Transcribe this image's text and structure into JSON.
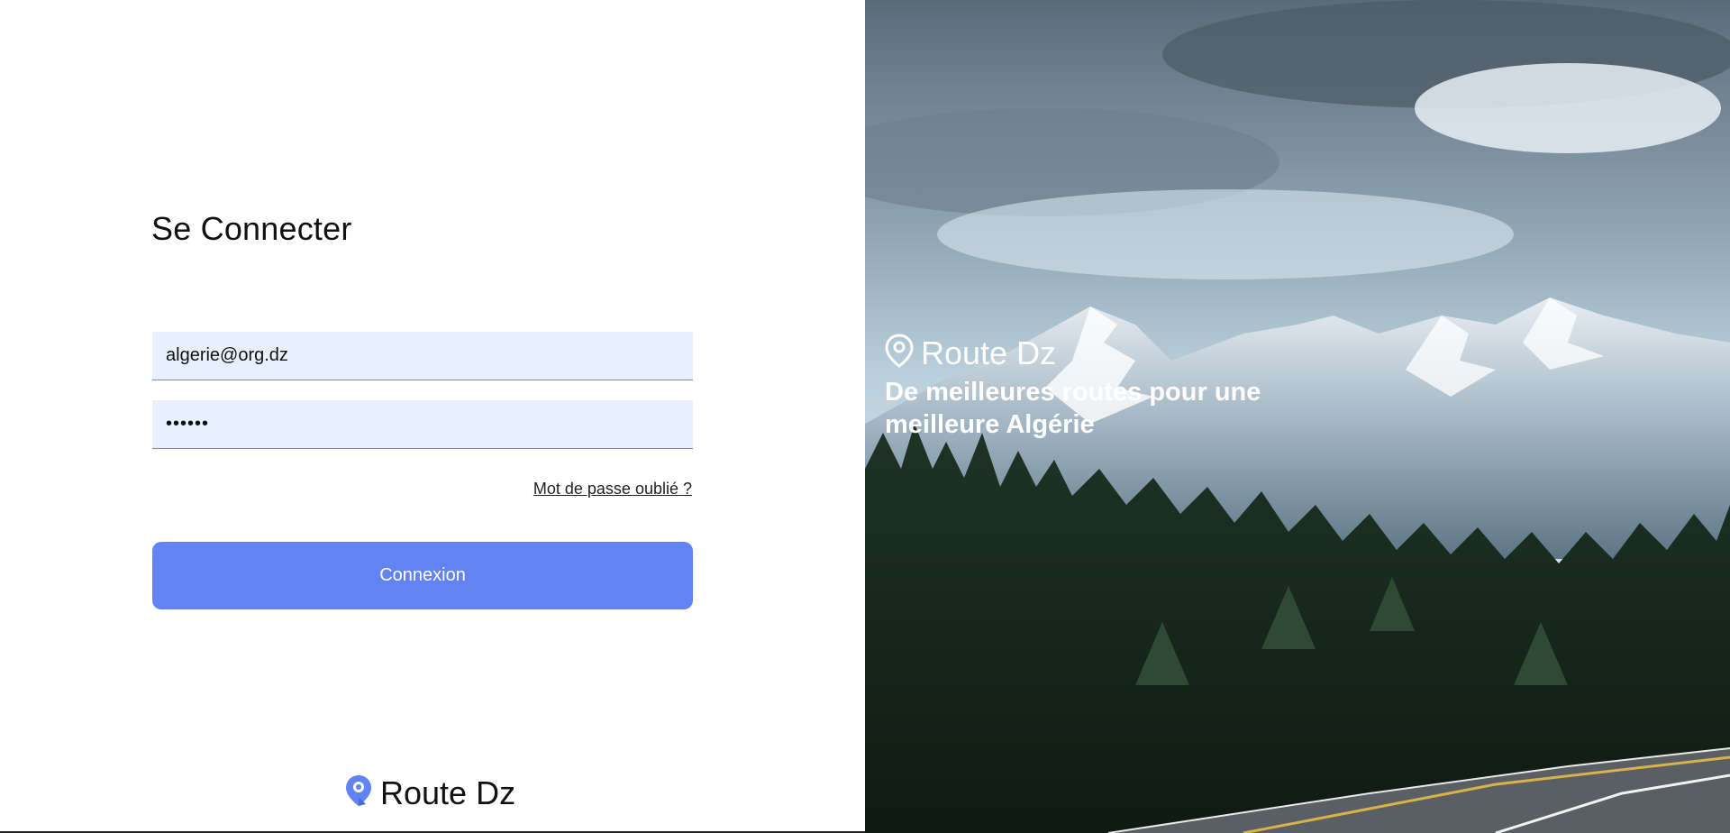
{
  "login": {
    "title": "Se Connecter",
    "email_value": "algerie@org.dz",
    "password_value": "••••••",
    "forgot_label": "Mot de passe oublié ?",
    "submit_label": "Connexion"
  },
  "footer": {
    "brand": "Route Dz",
    "icon": "map-pin-icon"
  },
  "hero": {
    "brand": "Route Dz",
    "icon": "map-pin-icon",
    "tagline": "De meilleures routes pour une meilleure Algérie"
  },
  "colors": {
    "accent": "#6183f4",
    "input_bg": "#e8effd",
    "text": "#111111"
  }
}
